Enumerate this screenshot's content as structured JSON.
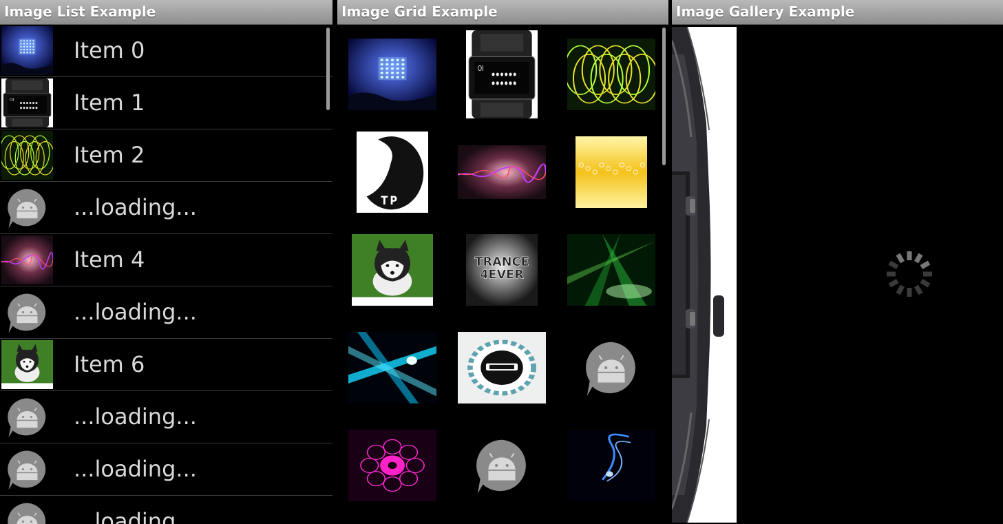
{
  "list_screen": {
    "title": "Image List Example",
    "items": [
      {
        "label": "Item 0",
        "image": "led-cube-concert"
      },
      {
        "label": "Item 1",
        "image": "binary-led-watch"
      },
      {
        "label": "Item 2",
        "image": "neon-spirals"
      },
      {
        "label": "...loading...",
        "image": "placeholder-android"
      },
      {
        "label": "Item 4",
        "image": "pink-soundwave"
      },
      {
        "label": "...loading...",
        "image": "placeholder-android"
      },
      {
        "label": "Item 6",
        "image": "husky-puppy"
      },
      {
        "label": "...loading...",
        "image": "placeholder-android"
      },
      {
        "label": "...loading...",
        "image": "placeholder-android"
      },
      {
        "label": "...loading...",
        "image": "placeholder-android"
      }
    ]
  },
  "grid_screen": {
    "title": "Image Grid Example",
    "cells": [
      {
        "image": "led-cube-concert"
      },
      {
        "image": "binary-led-watch"
      },
      {
        "image": "neon-spirals"
      },
      {
        "image": "tp-logo",
        "logo_text": "TP"
      },
      {
        "image": "pink-soundwave"
      },
      {
        "image": "yellow-equalizer"
      },
      {
        "image": "husky-puppy"
      },
      {
        "image": "trance-4ever",
        "logo_text": "TRANCE\n4EVER"
      },
      {
        "image": "green-laser-stage"
      },
      {
        "image": "cyan-light-burst"
      },
      {
        "image": "round-emblem"
      },
      {
        "image": "placeholder-android"
      },
      {
        "image": "magenta-kaleidoscope"
      },
      {
        "image": "placeholder-android"
      },
      {
        "image": "blue-light-swirl"
      }
    ]
  },
  "gallery_screen": {
    "title": "Image Gallery Example",
    "image": "binary-led-watch-side",
    "loading_indicator": "spinner-icon"
  },
  "colors": {
    "title_bar_top": "#b9b9b9",
    "title_bar_bottom": "#8e8e8e",
    "background": "#000000",
    "item_text": "#d9d9d9",
    "divider": "#3a3a3a"
  }
}
